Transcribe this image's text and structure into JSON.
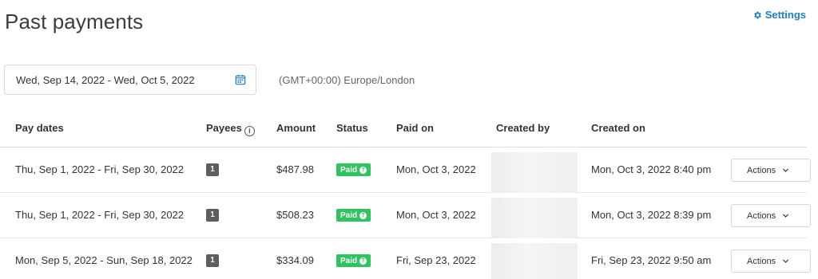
{
  "header": {
    "title": "Past payments",
    "settings_label": "Settings"
  },
  "filters": {
    "date_range": "Wed, Sep 14, 2022 - Wed, Oct 5, 2022",
    "timezone": "(GMT+00:00) Europe/London"
  },
  "table": {
    "columns": {
      "pay_dates": "Pay dates",
      "payees": "Payees",
      "amount": "Amount",
      "status": "Status",
      "paid_on": "Paid on",
      "created_by": "Created by",
      "created_on": "Created on"
    },
    "rows": [
      {
        "pay_dates": "Thu, Sep 1, 2022 - Fri, Sep 30, 2022",
        "payees": "1",
        "amount": "$487.98",
        "status": "Paid",
        "paid_on": "Mon, Oct 3, 2022",
        "created_on": "Mon, Oct 3, 2022 8:40 pm",
        "actions_label": "Actions"
      },
      {
        "pay_dates": "Thu, Sep 1, 2022 - Fri, Sep 30, 2022",
        "payees": "1",
        "amount": "$508.23",
        "status": "Paid",
        "paid_on": "Mon, Oct 3, 2022",
        "created_on": "Mon, Oct 3, 2022 8:39 pm",
        "actions_label": "Actions"
      },
      {
        "pay_dates": "Mon, Sep 5, 2022 - Sun, Sep 18, 2022",
        "payees": "1",
        "amount": "$334.09",
        "status": "Paid",
        "paid_on": "Fri, Sep 23, 2022",
        "created_on": "Fri, Sep 23, 2022 9:50 am",
        "actions_label": "Actions"
      }
    ]
  },
  "colors": {
    "accent": "#1e7cc8",
    "paid_status": "#2fc45f",
    "payee_badge": "#5e5e5e"
  },
  "icons": {
    "settings": "gear-icon",
    "calendar": "calendar-icon",
    "info": "info-icon",
    "status_help": "question-icon",
    "actions_dropdown": "chevron-down-icon"
  }
}
